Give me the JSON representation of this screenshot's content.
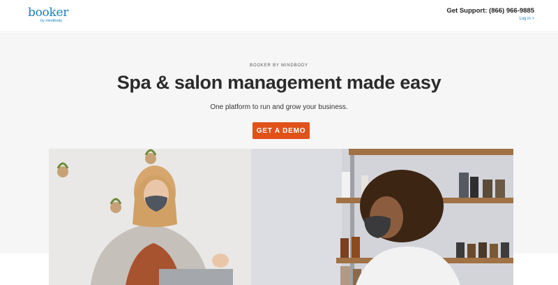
{
  "header": {
    "logo_text": "booker",
    "logo_sub": "by mindbody",
    "support_label": "Get Support: (866) 966-9885",
    "login_label": "Log in >"
  },
  "hero": {
    "eyebrow": "BOOKER BY MINDBODY",
    "title": "Spa & salon management made easy",
    "subtitle": "One platform to run and grow your business.",
    "cta_label": "GET A DEMO"
  },
  "colors": {
    "brand_blue": "#1a7fbf",
    "cta_orange": "#e0521a"
  }
}
